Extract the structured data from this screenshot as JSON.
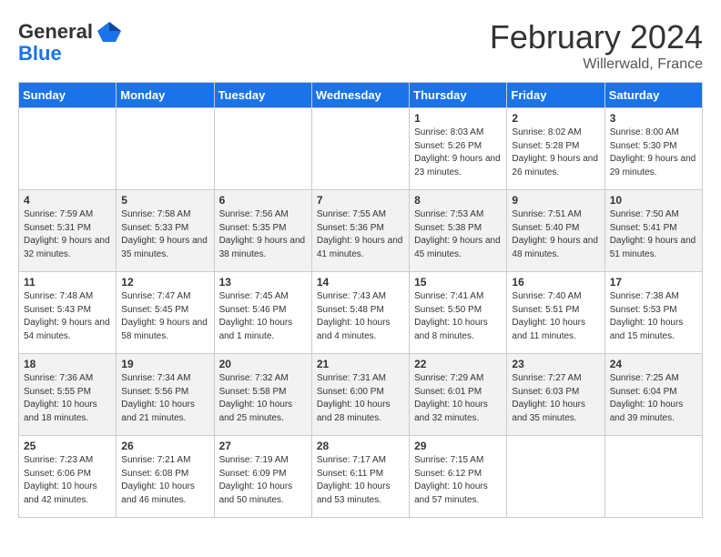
{
  "header": {
    "logo_line1": "General",
    "logo_line2": "Blue",
    "month_title": "February 2024",
    "location": "Willerwald, France"
  },
  "days_of_week": [
    "Sunday",
    "Monday",
    "Tuesday",
    "Wednesday",
    "Thursday",
    "Friday",
    "Saturday"
  ],
  "weeks": [
    [
      {
        "day": "",
        "sunrise": "",
        "sunset": "",
        "daylight": ""
      },
      {
        "day": "",
        "sunrise": "",
        "sunset": "",
        "daylight": ""
      },
      {
        "day": "",
        "sunrise": "",
        "sunset": "",
        "daylight": ""
      },
      {
        "day": "",
        "sunrise": "",
        "sunset": "",
        "daylight": ""
      },
      {
        "day": "1",
        "sunrise": "8:03 AM",
        "sunset": "5:26 PM",
        "daylight": "9 hours and 23 minutes."
      },
      {
        "day": "2",
        "sunrise": "8:02 AM",
        "sunset": "5:28 PM",
        "daylight": "9 hours and 26 minutes."
      },
      {
        "day": "3",
        "sunrise": "8:00 AM",
        "sunset": "5:30 PM",
        "daylight": "9 hours and 29 minutes."
      }
    ],
    [
      {
        "day": "4",
        "sunrise": "7:59 AM",
        "sunset": "5:31 PM",
        "daylight": "9 hours and 32 minutes."
      },
      {
        "day": "5",
        "sunrise": "7:58 AM",
        "sunset": "5:33 PM",
        "daylight": "9 hours and 35 minutes."
      },
      {
        "day": "6",
        "sunrise": "7:56 AM",
        "sunset": "5:35 PM",
        "daylight": "9 hours and 38 minutes."
      },
      {
        "day": "7",
        "sunrise": "7:55 AM",
        "sunset": "5:36 PM",
        "daylight": "9 hours and 41 minutes."
      },
      {
        "day": "8",
        "sunrise": "7:53 AM",
        "sunset": "5:38 PM",
        "daylight": "9 hours and 45 minutes."
      },
      {
        "day": "9",
        "sunrise": "7:51 AM",
        "sunset": "5:40 PM",
        "daylight": "9 hours and 48 minutes."
      },
      {
        "day": "10",
        "sunrise": "7:50 AM",
        "sunset": "5:41 PM",
        "daylight": "9 hours and 51 minutes."
      }
    ],
    [
      {
        "day": "11",
        "sunrise": "7:48 AM",
        "sunset": "5:43 PM",
        "daylight": "9 hours and 54 minutes."
      },
      {
        "day": "12",
        "sunrise": "7:47 AM",
        "sunset": "5:45 PM",
        "daylight": "9 hours and 58 minutes."
      },
      {
        "day": "13",
        "sunrise": "7:45 AM",
        "sunset": "5:46 PM",
        "daylight": "10 hours and 1 minute."
      },
      {
        "day": "14",
        "sunrise": "7:43 AM",
        "sunset": "5:48 PM",
        "daylight": "10 hours and 4 minutes."
      },
      {
        "day": "15",
        "sunrise": "7:41 AM",
        "sunset": "5:50 PM",
        "daylight": "10 hours and 8 minutes."
      },
      {
        "day": "16",
        "sunrise": "7:40 AM",
        "sunset": "5:51 PM",
        "daylight": "10 hours and 11 minutes."
      },
      {
        "day": "17",
        "sunrise": "7:38 AM",
        "sunset": "5:53 PM",
        "daylight": "10 hours and 15 minutes."
      }
    ],
    [
      {
        "day": "18",
        "sunrise": "7:36 AM",
        "sunset": "5:55 PM",
        "daylight": "10 hours and 18 minutes."
      },
      {
        "day": "19",
        "sunrise": "7:34 AM",
        "sunset": "5:56 PM",
        "daylight": "10 hours and 21 minutes."
      },
      {
        "day": "20",
        "sunrise": "7:32 AM",
        "sunset": "5:58 PM",
        "daylight": "10 hours and 25 minutes."
      },
      {
        "day": "21",
        "sunrise": "7:31 AM",
        "sunset": "6:00 PM",
        "daylight": "10 hours and 28 minutes."
      },
      {
        "day": "22",
        "sunrise": "7:29 AM",
        "sunset": "6:01 PM",
        "daylight": "10 hours and 32 minutes."
      },
      {
        "day": "23",
        "sunrise": "7:27 AM",
        "sunset": "6:03 PM",
        "daylight": "10 hours and 35 minutes."
      },
      {
        "day": "24",
        "sunrise": "7:25 AM",
        "sunset": "6:04 PM",
        "daylight": "10 hours and 39 minutes."
      }
    ],
    [
      {
        "day": "25",
        "sunrise": "7:23 AM",
        "sunset": "6:06 PM",
        "daylight": "10 hours and 42 minutes."
      },
      {
        "day": "26",
        "sunrise": "7:21 AM",
        "sunset": "6:08 PM",
        "daylight": "10 hours and 46 minutes."
      },
      {
        "day": "27",
        "sunrise": "7:19 AM",
        "sunset": "6:09 PM",
        "daylight": "10 hours and 50 minutes."
      },
      {
        "day": "28",
        "sunrise": "7:17 AM",
        "sunset": "6:11 PM",
        "daylight": "10 hours and 53 minutes."
      },
      {
        "day": "29",
        "sunrise": "7:15 AM",
        "sunset": "6:12 PM",
        "daylight": "10 hours and 57 minutes."
      },
      {
        "day": "",
        "sunrise": "",
        "sunset": "",
        "daylight": ""
      },
      {
        "day": "",
        "sunrise": "",
        "sunset": "",
        "daylight": ""
      }
    ]
  ]
}
